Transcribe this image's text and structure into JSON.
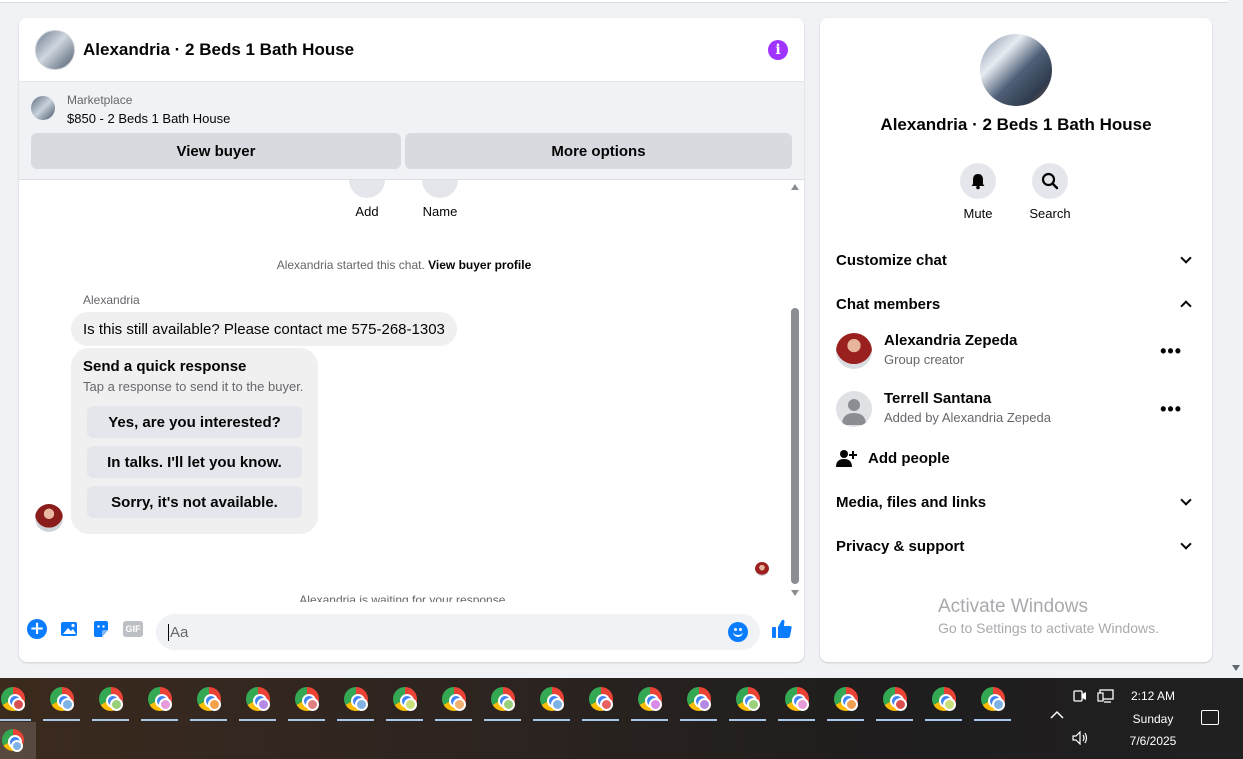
{
  "chat": {
    "title": "Alexandria · 2 Beds 1 Bath House",
    "marketplace_label": "Marketplace",
    "listing": "$850 - 2 Beds 1 Bath House",
    "view_buyer": "View buyer",
    "more_options": "More options",
    "actions": [
      {
        "label": "Add"
      },
      {
        "label": "Name"
      }
    ],
    "started_text": "Alexandria started this chat.",
    "view_profile_link": "View buyer profile",
    "sender": "Alexandria",
    "message": "Is this still available? Please contact me 575-268-1303",
    "quick_response": {
      "title": "Send a quick response",
      "subtitle": "Tap a response to send it to the buyer.",
      "options": [
        "Yes, are you interested?",
        "In talks. I'll let you know.",
        "Sorry, it's not available."
      ]
    },
    "waiting_text": "Alexandria is waiting for your response.",
    "composer_placeholder": "Aa",
    "gif_label": "GIF"
  },
  "side": {
    "title": "Alexandria · 2 Beds 1 Bath House",
    "mute_label": "Mute",
    "search_label": "Search",
    "customize_chat": "Customize chat",
    "chat_members": "Chat members",
    "members": [
      {
        "name": "Alexandria Zepeda",
        "role": "Group creator"
      },
      {
        "name": "Terrell Santana",
        "role": "Added by Alexandria Zepeda"
      }
    ],
    "add_people": "Add people",
    "media_files": "Media, files and links",
    "privacy_support": "Privacy & support"
  },
  "watermark": {
    "line1": "Activate Windows",
    "line2": "Go to Settings to activate Windows."
  },
  "taskbar": {
    "time": "2:12 AM",
    "day": "Sunday",
    "date": "7/6/2025",
    "badge_colors": [
      "#d94f4f",
      "#7fb2e5",
      "#9ad07a",
      "#e59bd9",
      "#f5a04a",
      "#b48ae6",
      "#e08080",
      "#7fb2e5",
      "#c9e07a",
      "#f0b070",
      "#9ad07a",
      "#7fb2e5",
      "#e86060",
      "#d88ae6",
      "#b48ae6",
      "#9ad07a",
      "#e59bd9",
      "#f0a050",
      "#d94f4f",
      "#c9e07a",
      "#7fb2e5"
    ]
  },
  "colors": {
    "messenger_blue": "#0a7cff",
    "info_purple": "#a033ff"
  }
}
